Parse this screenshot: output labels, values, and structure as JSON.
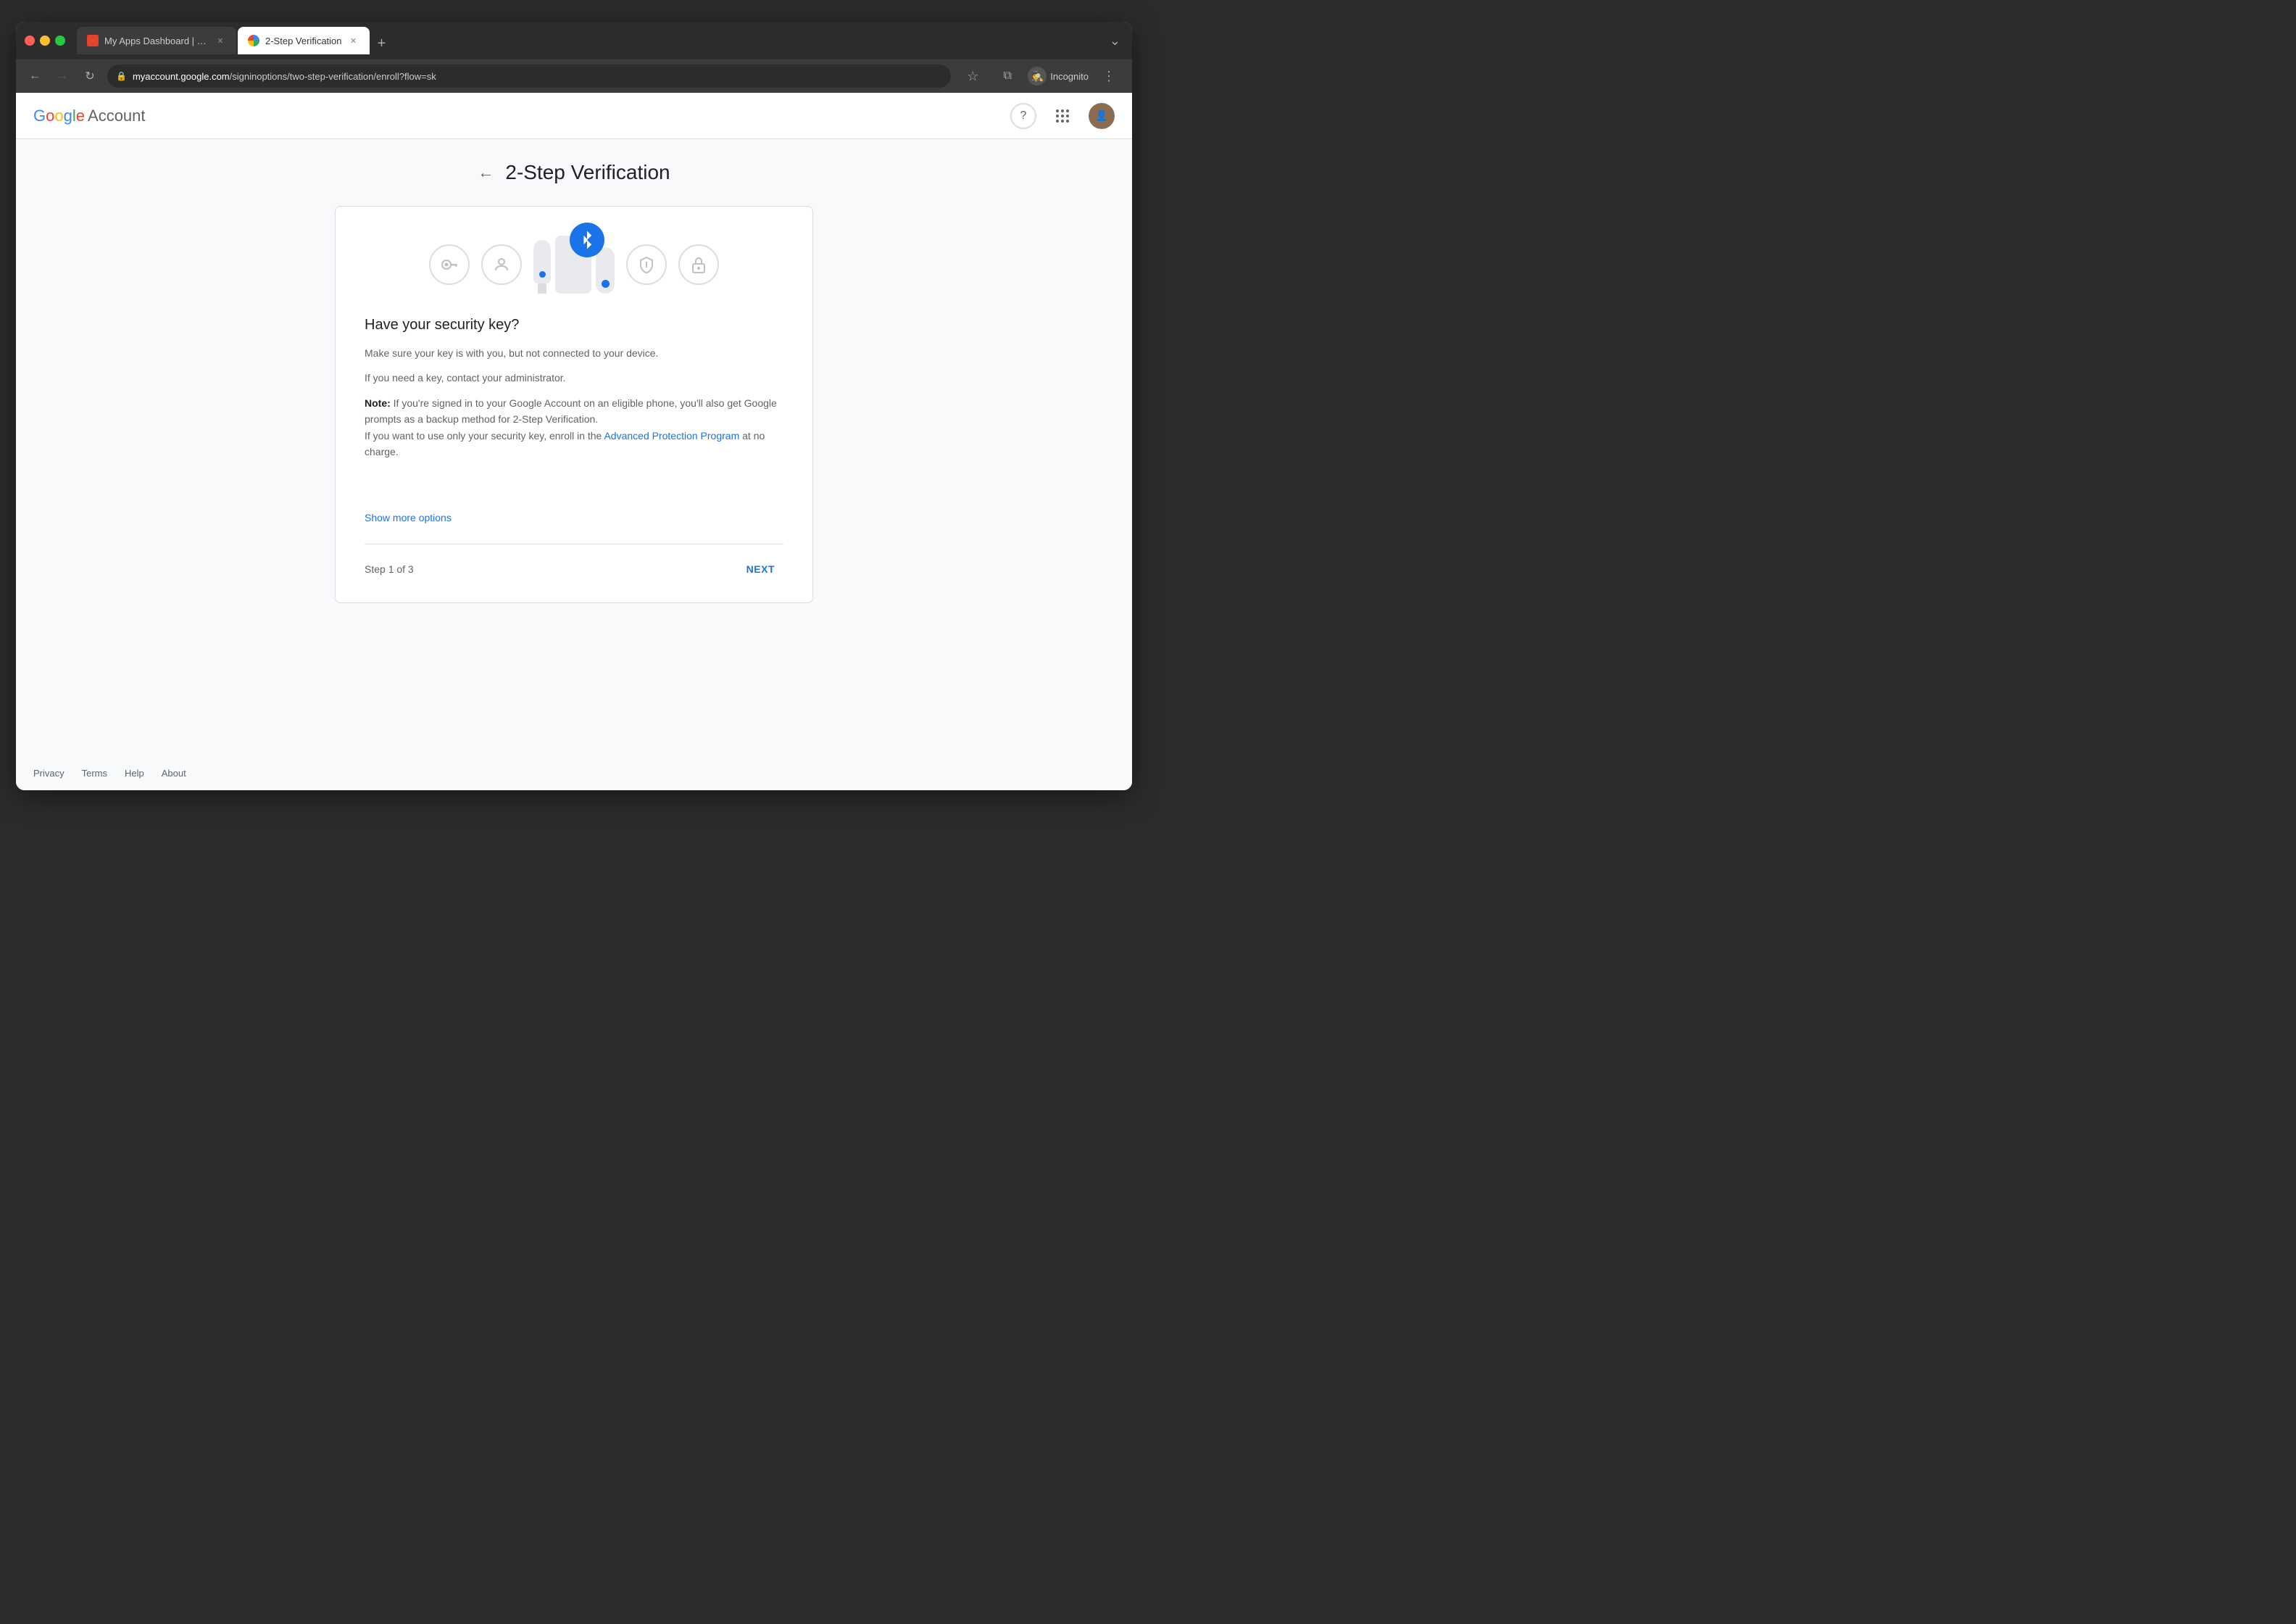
{
  "browser": {
    "tabs": [
      {
        "id": "gitlab",
        "title": "My Apps Dashboard | GitLab",
        "active": false,
        "favicon": "gitlab"
      },
      {
        "id": "google-2sv",
        "title": "2-Step Verification",
        "active": true,
        "favicon": "google"
      }
    ],
    "new_tab_label": "+",
    "url": {
      "protocol": "myaccount.google.com",
      "path": "/signinoptions/two-step-verification/enroll?flow=sk",
      "full": "myaccount.google.com/signinoptions/two-step-verification/enroll?flow=sk"
    },
    "incognito_label": "Incognito",
    "nav": {
      "back": "←",
      "forward": "→",
      "refresh": "↻"
    }
  },
  "header": {
    "google_text": "Google",
    "account_text": "Account",
    "help_icon": "?",
    "apps_icon": "⋮⋮⋮"
  },
  "page": {
    "back_arrow": "←",
    "title": "2-Step Verification"
  },
  "card": {
    "heading": "Have your security key?",
    "body1": "Make sure your key is with you, but not connected to your device.",
    "body2": "If you need a key, contact your administrator.",
    "note_label": "Note:",
    "note_body": " If you're signed in to your Google Account on an eligible phone, you'll also get Google prompts as a backup method for 2-Step Verification.",
    "note_body2": "If you want to use only your security key, enroll in the ",
    "advanced_protection_link": "Advanced Protection Program",
    "note_body3": " at no charge.",
    "show_more_options": "Show more options",
    "step_label": "Step 1 of 3",
    "next_button": "NEXT"
  },
  "footer": {
    "links": [
      "Privacy",
      "Terms",
      "Help",
      "About"
    ]
  },
  "icons": {
    "key": "🔑",
    "person": "👤",
    "shield": "🛡",
    "lock": "🔒",
    "bluetooth": "Ƀ",
    "question": "?",
    "apps": "⊞"
  }
}
